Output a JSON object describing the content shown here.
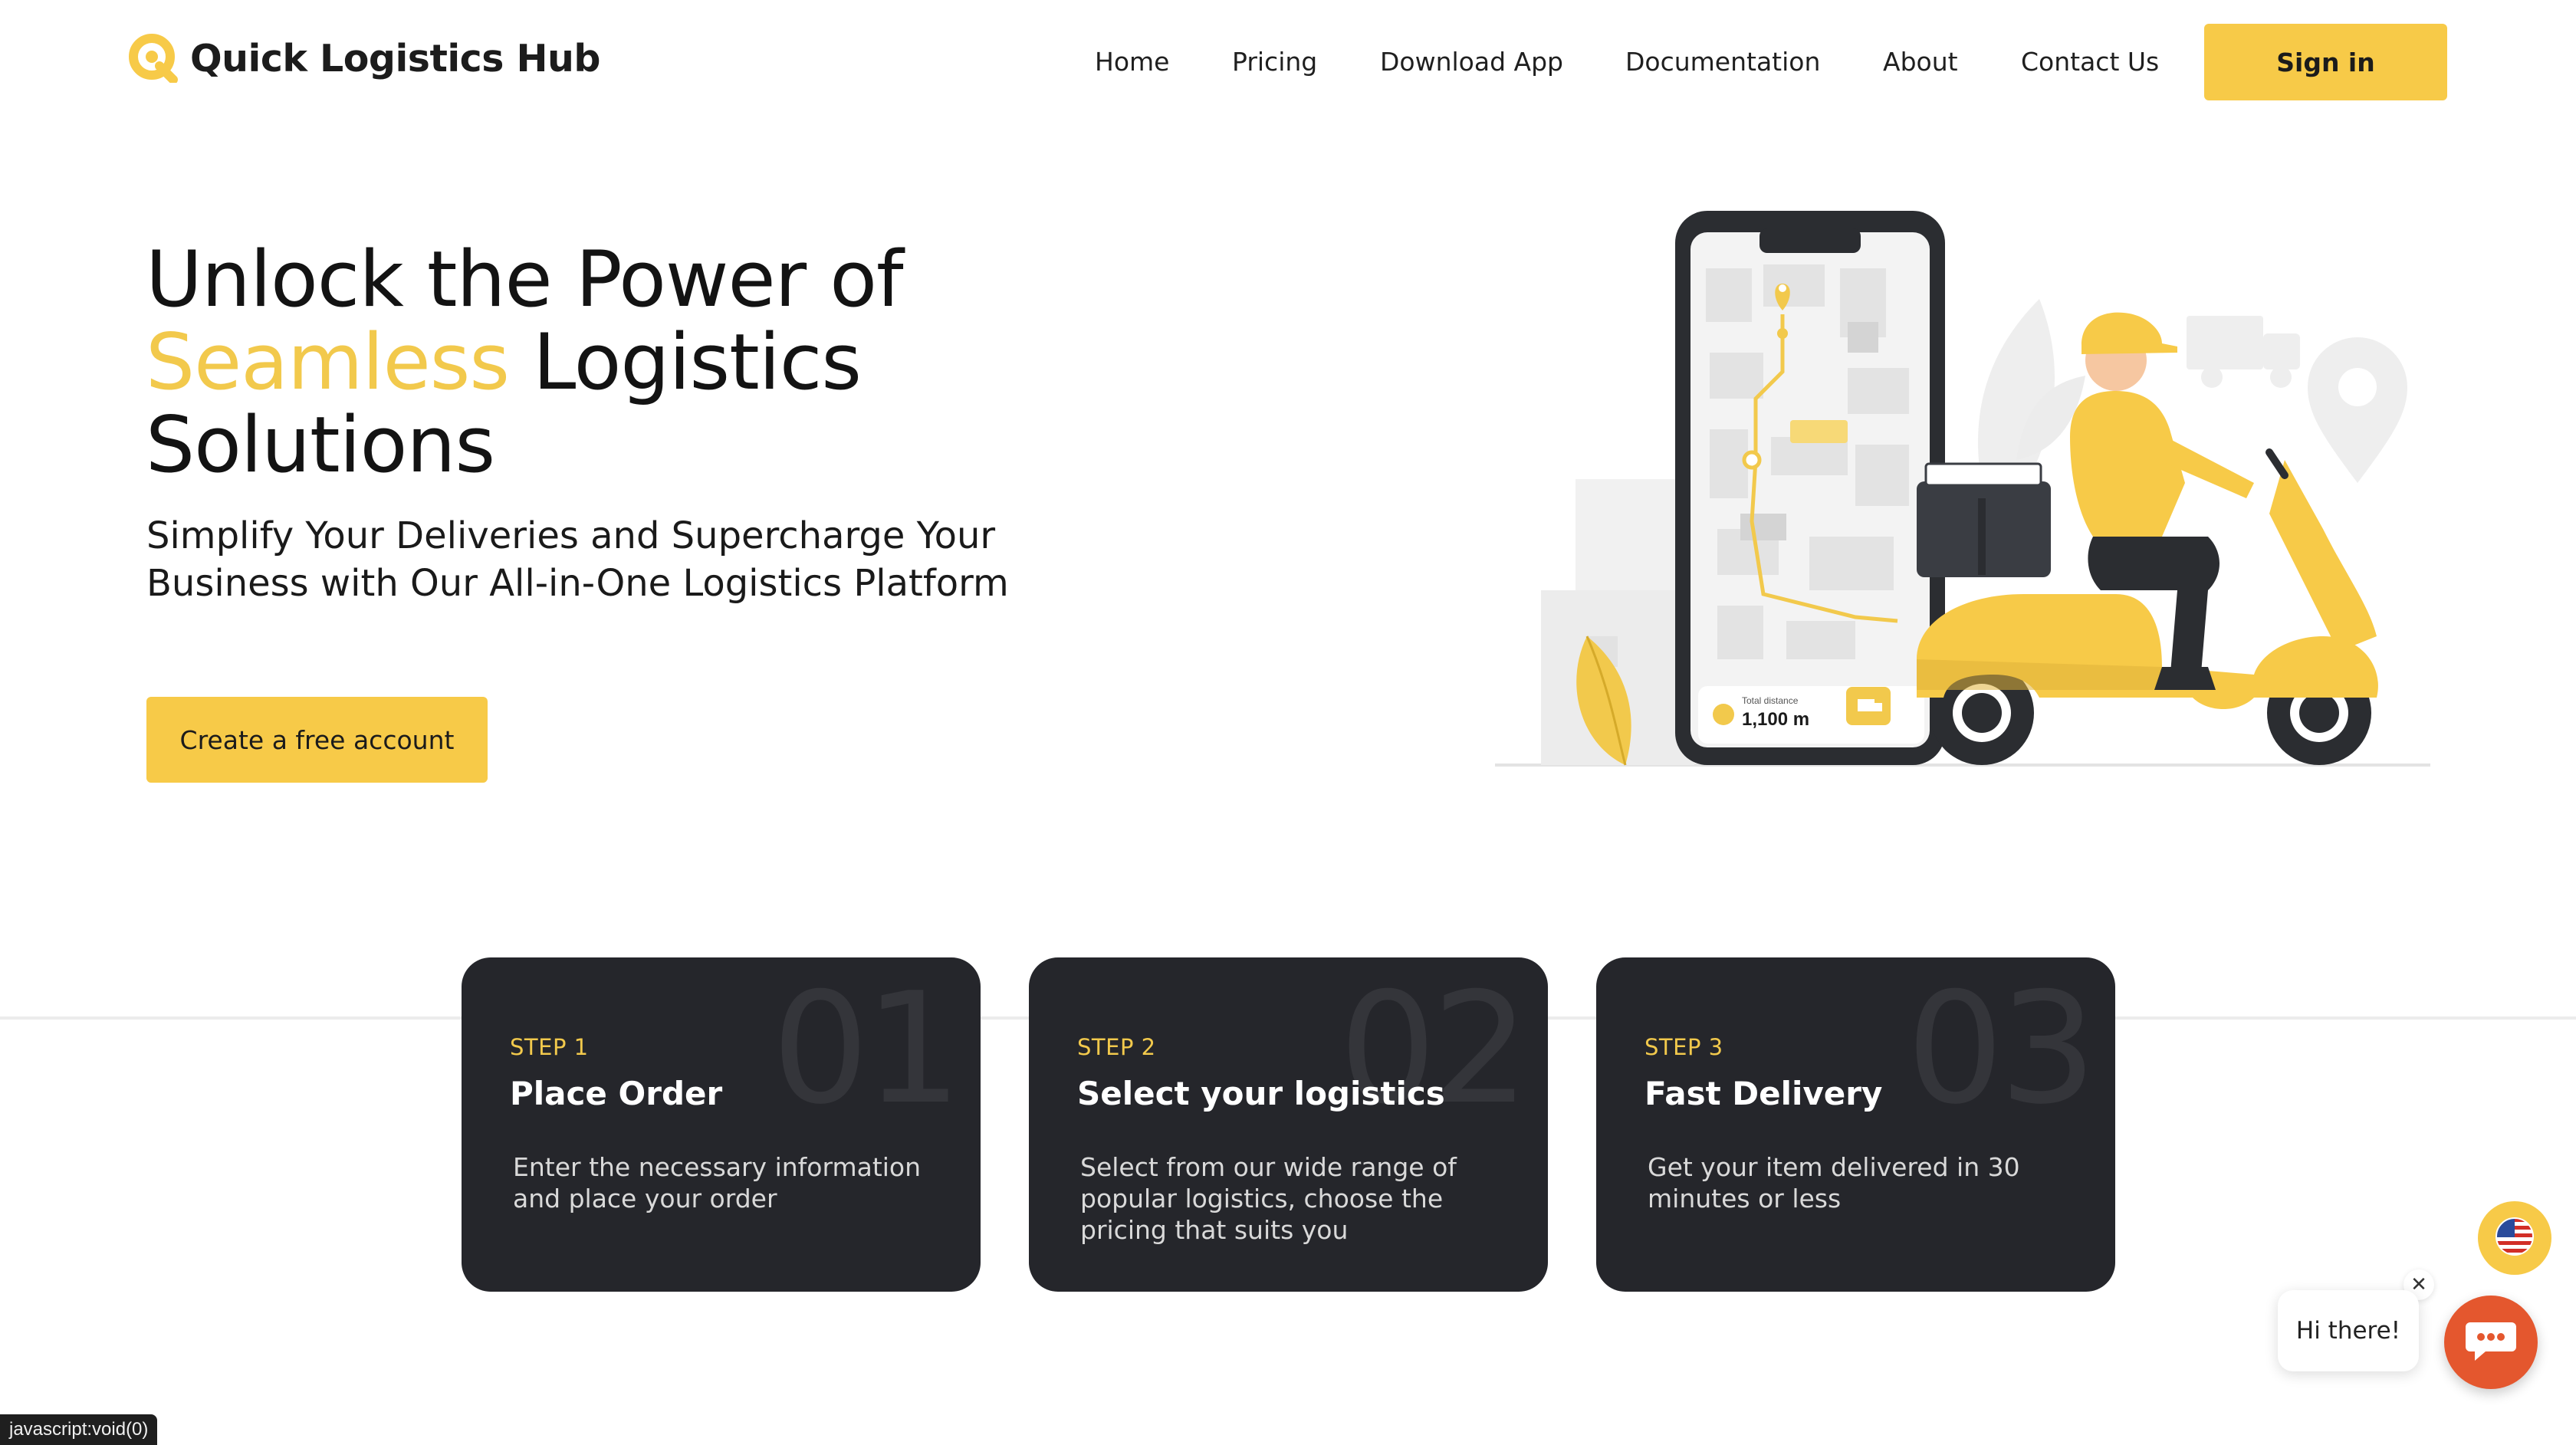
{
  "brand": {
    "name": "Quick Logistics Hub",
    "icon": "logo-q-icon",
    "accent_color": "#f7ca48"
  },
  "nav": {
    "items": [
      {
        "label": "Home"
      },
      {
        "label": "Pricing"
      },
      {
        "label": "Download App"
      },
      {
        "label": "Documentation"
      },
      {
        "label": "About"
      },
      {
        "label": "Contact Us"
      }
    ],
    "signin_label": "Sign in"
  },
  "hero": {
    "title_line1": "Unlock the Power of",
    "title_accent": "Seamless",
    "title_line2_rest": " Logistics",
    "title_line3": "Solutions",
    "subtitle_line1": "Simplify Your Deliveries and Supercharge Your",
    "subtitle_line2": "Business with Our All-in-One Logistics Platform",
    "cta_label": "Create a free account",
    "illustration": {
      "total_distance_label": "Total distance",
      "total_distance_value": "1,100 m"
    }
  },
  "steps": [
    {
      "number": "01",
      "step_label": "STEP 1",
      "title": "Place Order",
      "description": "Enter the necessary information and place your order"
    },
    {
      "number": "02",
      "step_label": "STEP 2",
      "title": "Select your logistics",
      "description": "Select from our wide range of popular logistics, choose the pricing that suits you"
    },
    {
      "number": "03",
      "step_label": "STEP 3",
      "title": "Fast Delivery",
      "description": "Get your item delivered in 30 minutes or less"
    }
  ],
  "widgets": {
    "language_icon": "us-flag-icon",
    "chat_greeting": "Hi there!",
    "chat_close_icon": "close-icon",
    "chat_icon": "chat-icon",
    "chat_color": "#e4572e"
  },
  "status_bar": {
    "text": "javascript:void(0)"
  }
}
